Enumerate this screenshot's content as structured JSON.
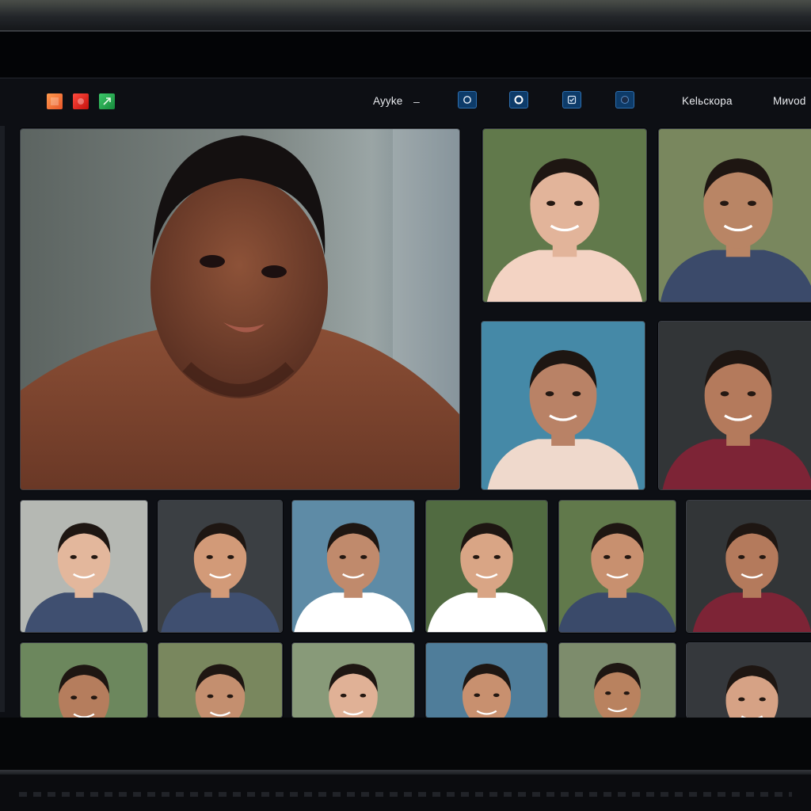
{
  "toolbar": {
    "window_buttons": [
      {
        "name": "orange-window-icon",
        "color": "#f07a3a"
      },
      {
        "name": "red-window-icon",
        "color": "#e0231d"
      },
      {
        "name": "green-window-icon",
        "color": "#27a34f"
      }
    ],
    "label_left": "Ayyke",
    "dash": "–",
    "icons": [
      "camera-icon",
      "record-icon",
      "shield-check-icon",
      "circle-icon"
    ],
    "label_mid": "Kelьскоpa",
    "label_right": "Mиvod"
  },
  "video_tiles": {
    "featured": {
      "icon": "person-silhouette",
      "skin": "#7a4631",
      "bg": "#6f7a77"
    },
    "grid": [
      {
        "skin": "#e2b49a",
        "bg": "#6f8a56",
        "shirt": "#f3d3c3"
      },
      {
        "skin": "#b98565",
        "bg": "#8a9a6c",
        "shirt": "#3b4a6a"
      },
      {
        "skin": "#b98266",
        "bg": "#4f9dbf",
        "shirt": "#efd9cc"
      },
      {
        "skin": "#b47a5c",
        "bg": "#3a3d3f",
        "shirt": "#7d2436"
      },
      {
        "skin": "#e3b79c",
        "bg": "#cfd2cc",
        "shirt": "#3f4f70"
      },
      {
        "skin": "#d29a78",
        "bg": "#44484d",
        "shirt": "#3f4f70"
      },
      {
        "skin": "#c08a6c",
        "bg": "#6c9fbe",
        "shirt": "#ffffff"
      },
      {
        "skin": "#d9a585",
        "bg": "#5d7a4a",
        "shirt": "#ffffff"
      },
      {
        "skin": "#c8906f",
        "bg": "#6f8a56",
        "shirt": "#3a4a6a"
      },
      {
        "skin": "#b47a5c",
        "bg": "#3a3d3f",
        "shirt": "#7d2436"
      },
      {
        "skin": "#b57d5d",
        "bg": "#7c9a6a",
        "shirt": "#333333"
      },
      {
        "skin": "#c48f6f",
        "bg": "#8a9a6c",
        "shirt": "#444444"
      },
      {
        "skin": "#e0b196",
        "bg": "#9bb08a",
        "shirt": "#dddddd"
      },
      {
        "skin": "#c8906f",
        "bg": "#5a8fb0",
        "shirt": "#222222"
      },
      {
        "skin": "#b9825f",
        "bg": "#8fa07c",
        "shirt": "#333333"
      },
      {
        "skin": "#d6a285",
        "bg": "#3d4045",
        "shirt": "#555555"
      }
    ]
  }
}
